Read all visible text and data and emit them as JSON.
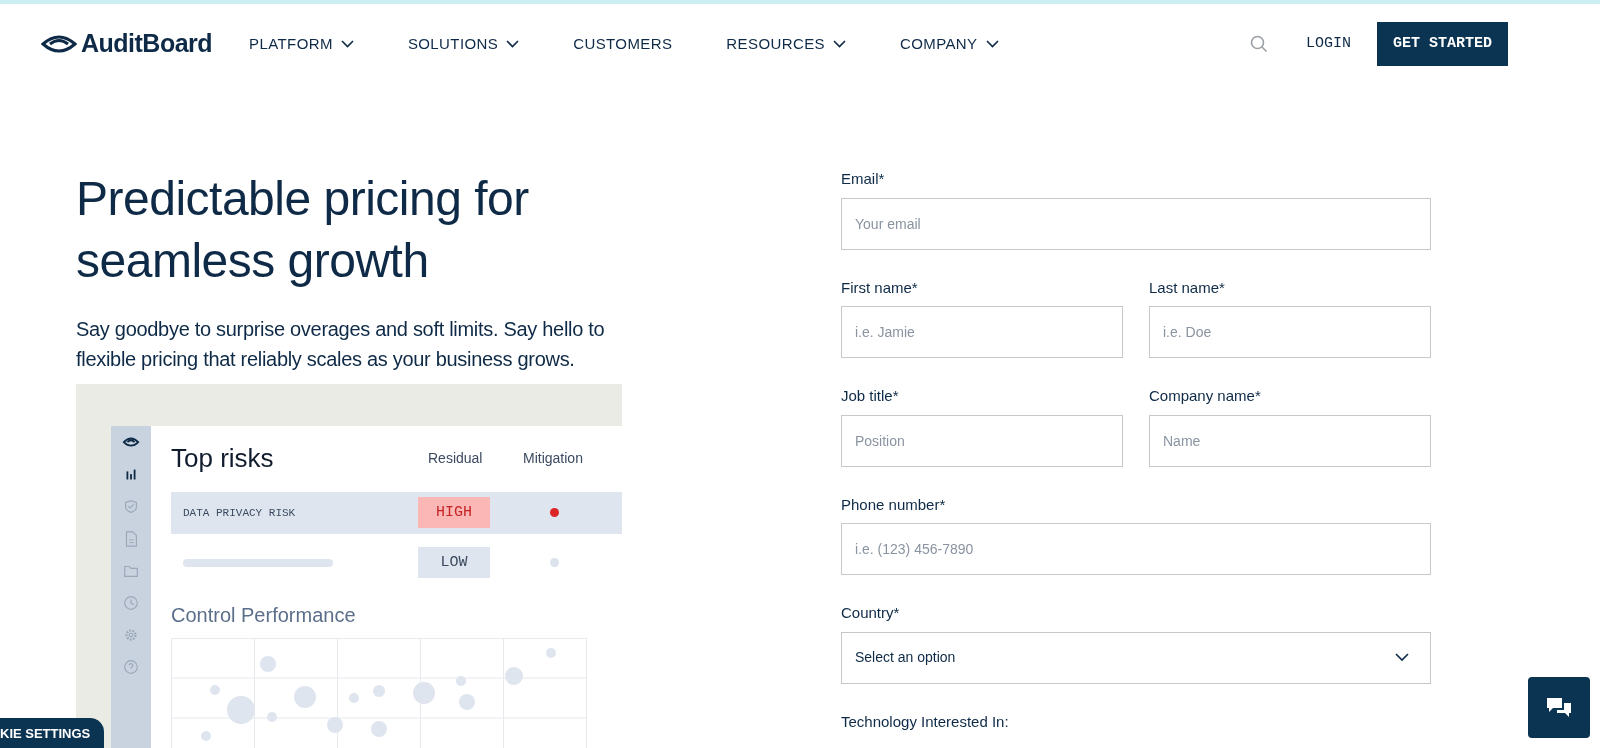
{
  "header": {
    "logo": "AuditBoard",
    "nav": [
      {
        "label": "PLATFORM",
        "dropdown": true
      },
      {
        "label": "SOLUTIONS",
        "dropdown": true
      },
      {
        "label": "CUSTOMERS",
        "dropdown": false
      },
      {
        "label": "RESOURCES",
        "dropdown": true
      },
      {
        "label": "COMPANY",
        "dropdown": true
      }
    ],
    "login": "LOGIN",
    "cta": "GET STARTED"
  },
  "hero": {
    "title": "Predictable pricing for seamless growth",
    "text": "Say goodbye to surprise overages and soft limits. Say hello to flexible pricing that reliably scales as your business grows."
  },
  "illustration": {
    "title": "Top risks",
    "columns": [
      "Residual",
      "Mitigation"
    ],
    "rows": [
      {
        "label": "DATA PRIVACY RISK",
        "residual": "HIGH",
        "kind": "high",
        "selected": true,
        "color": "#dc2626"
      },
      {
        "residual": "LOW",
        "kind": "low",
        "selected": false,
        "color": "#dbe2ec"
      }
    ],
    "chart_title": "Control Performance"
  },
  "form": {
    "fields": [
      {
        "label": "Email*",
        "placeholder": "Your email",
        "kind": "input"
      },
      {
        "label": "First name*",
        "placeholder": "i.e. Jamie",
        "kind": "input"
      },
      {
        "label": "Last name*",
        "placeholder": "i.e. Doe",
        "kind": "input"
      },
      {
        "label": "Job title*",
        "placeholder": "Position",
        "kind": "input"
      },
      {
        "label": "Company name*",
        "placeholder": "Name",
        "kind": "input"
      },
      {
        "label": "Phone number*",
        "placeholder": "i.e. (123) 456-7890",
        "kind": "input"
      },
      {
        "label": "Country*",
        "value": "Select an option",
        "kind": "select"
      },
      {
        "label": "Technology Interested In:",
        "kind": "label"
      }
    ]
  },
  "cookie_button": "KIE SETTINGS"
}
